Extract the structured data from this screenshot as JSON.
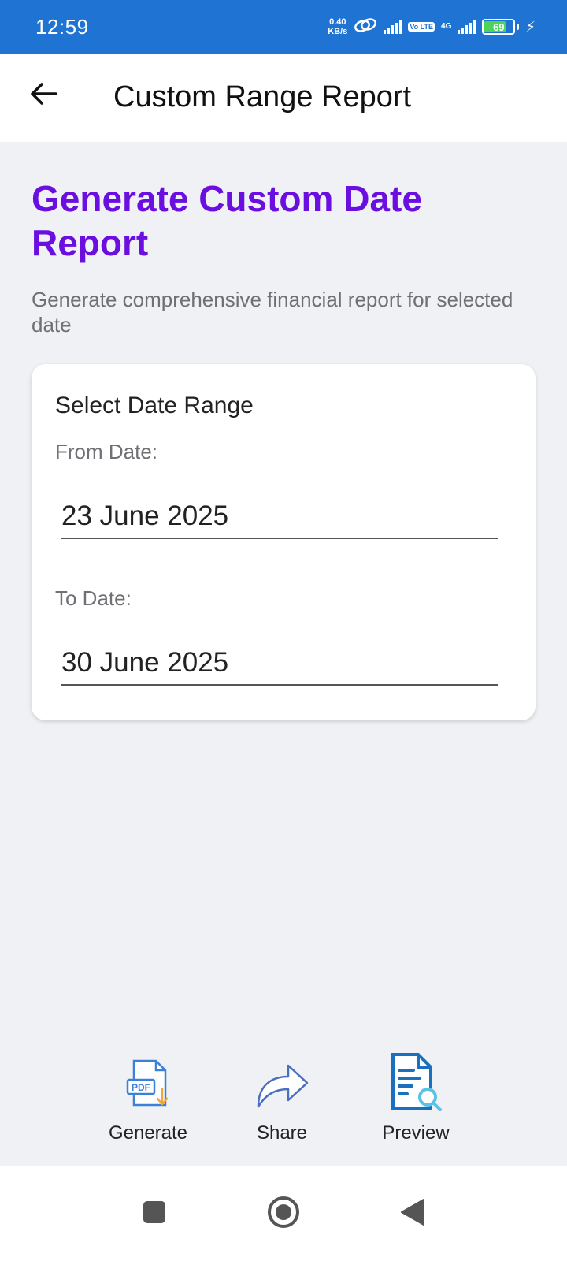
{
  "status_bar": {
    "time": "12:59",
    "net_speed_value": "0.40",
    "net_speed_unit": "KB/s",
    "volte": "Vo LTE",
    "network": "4G",
    "battery": "69"
  },
  "app_bar": {
    "title": "Custom Range Report",
    "back_icon": "arrow-left-icon"
  },
  "main": {
    "heading": "Generate Custom Date Report",
    "subheading": "Generate comprehensive financial report for selected date"
  },
  "card": {
    "title": "Select Date Range",
    "from_label": "From Date:",
    "from_value": "23 June 2025",
    "to_label": "To Date:",
    "to_value": "30 June 2025"
  },
  "actions": {
    "generate": {
      "label": "Generate",
      "icon": "pdf-download-icon"
    },
    "share": {
      "label": "Share",
      "icon": "share-arrow-icon"
    },
    "preview": {
      "label": "Preview",
      "icon": "document-search-icon"
    }
  },
  "nav": {
    "recents_icon": "square-icon",
    "home_icon": "circle-icon",
    "back_icon": "triangle-back-icon"
  },
  "colors": {
    "status_bar": "#1f74d3",
    "heading": "#6a0fe0",
    "background": "#f0f1f4",
    "battery_fill": "#4cd35a"
  }
}
